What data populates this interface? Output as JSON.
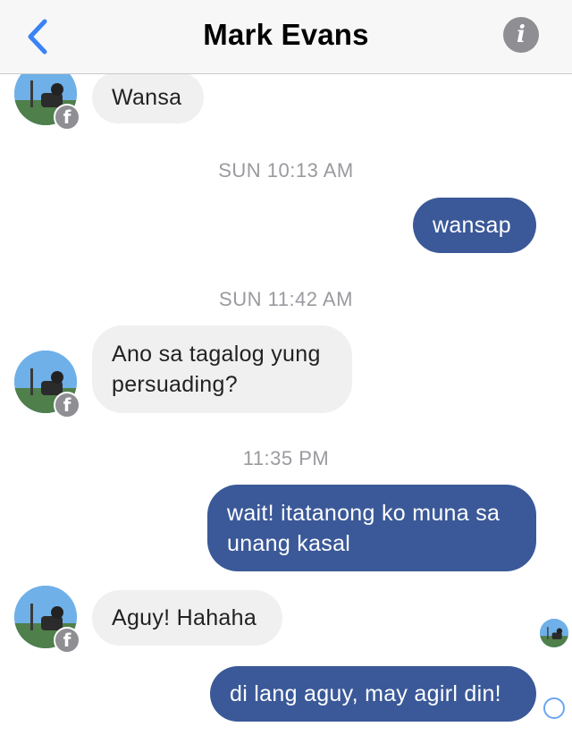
{
  "header": {
    "title": "Mark Evans",
    "back_icon": "chevron-left-icon",
    "info_icon": "info-icon",
    "info_glyph": "i",
    "accent_color": "#3b82f6"
  },
  "contact": {
    "badge_icon": "facebook-icon",
    "badge_glyph": "f"
  },
  "messages": [
    {
      "type": "incoming",
      "text": "Wansa"
    },
    {
      "type": "timestamp",
      "text": "SUN 10:13 AM"
    },
    {
      "type": "outgoing",
      "text": "wansap"
    },
    {
      "type": "timestamp",
      "text": "SUN 11:42 AM"
    },
    {
      "type": "incoming",
      "text": "Ano sa tagalog yung persuading?"
    },
    {
      "type": "timestamp",
      "text": "11:35 PM"
    },
    {
      "type": "outgoing",
      "text": "wait! itatanong ko muna sa unang kasal"
    },
    {
      "type": "incoming",
      "text": "Aguy! Hahaha"
    },
    {
      "type": "outgoing",
      "text": "di lang aguy, may agirl din!"
    }
  ],
  "colors": {
    "outgoing_bubble": "#3b5998",
    "incoming_bubble": "#f1f0f0",
    "timestamp_text": "#9a9a9f"
  }
}
